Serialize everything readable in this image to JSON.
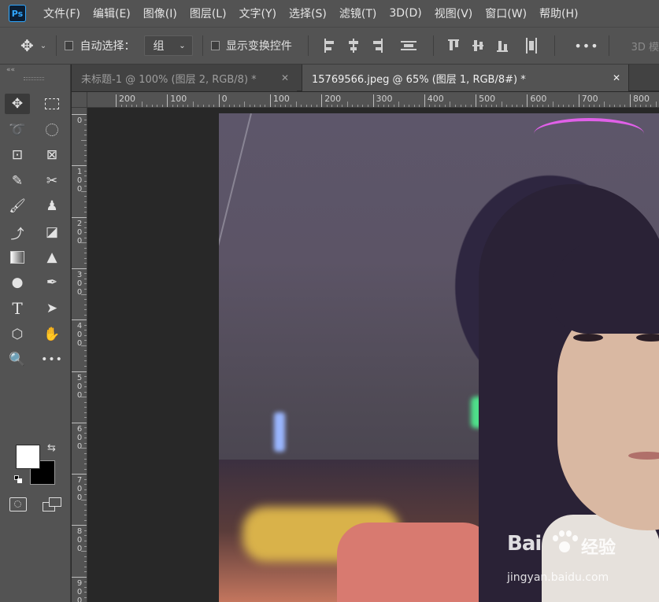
{
  "app": {
    "logo_text": "Ps"
  },
  "menu": [
    "文件(F)",
    "编辑(E)",
    "图像(I)",
    "图层(L)",
    "文字(Y)",
    "选择(S)",
    "滤镜(T)",
    "3D(D)",
    "视图(V)",
    "窗口(W)",
    "帮助(H)"
  ],
  "options": {
    "auto_select_label": "自动选择：",
    "auto_select_value": "组",
    "show_transform_label": "显示变换控件",
    "more_label": "•••",
    "mode_3d_label": "3D 模"
  },
  "toolbar": {
    "collapse_label": "««",
    "more_tools_label": "•••"
  },
  "tabs": [
    {
      "label": "未标题-1 @ 100% (图层 2, RGB/8) *",
      "close": "✕"
    },
    {
      "label": "15769566.jpeg @ 65% (图层 1, RGB/8#) *",
      "close": "✕"
    }
  ],
  "ruler_h": [
    "200",
    "100",
    "0",
    "100",
    "200",
    "300",
    "400",
    "500",
    "600",
    "700",
    "800"
  ],
  "ruler_v": [
    [
      "0"
    ],
    [
      "1",
      "0",
      "0"
    ],
    [
      "2",
      "0",
      "0"
    ],
    [
      "3",
      "0",
      "0"
    ],
    [
      "4",
      "0",
      "0"
    ],
    [
      "5",
      "0",
      "0"
    ],
    [
      "6",
      "0",
      "0"
    ],
    [
      "7",
      "0",
      "0"
    ],
    [
      "8",
      "0",
      "0"
    ],
    [
      "9",
      "0",
      "0"
    ]
  ],
  "watermark": {
    "brand_a": "Bai",
    "brand_b": "经验",
    "url": "jingyan.baidu.com"
  },
  "colors": {
    "foreground": "#ffffff",
    "background": "#000000",
    "accent": "#31a8ff"
  }
}
